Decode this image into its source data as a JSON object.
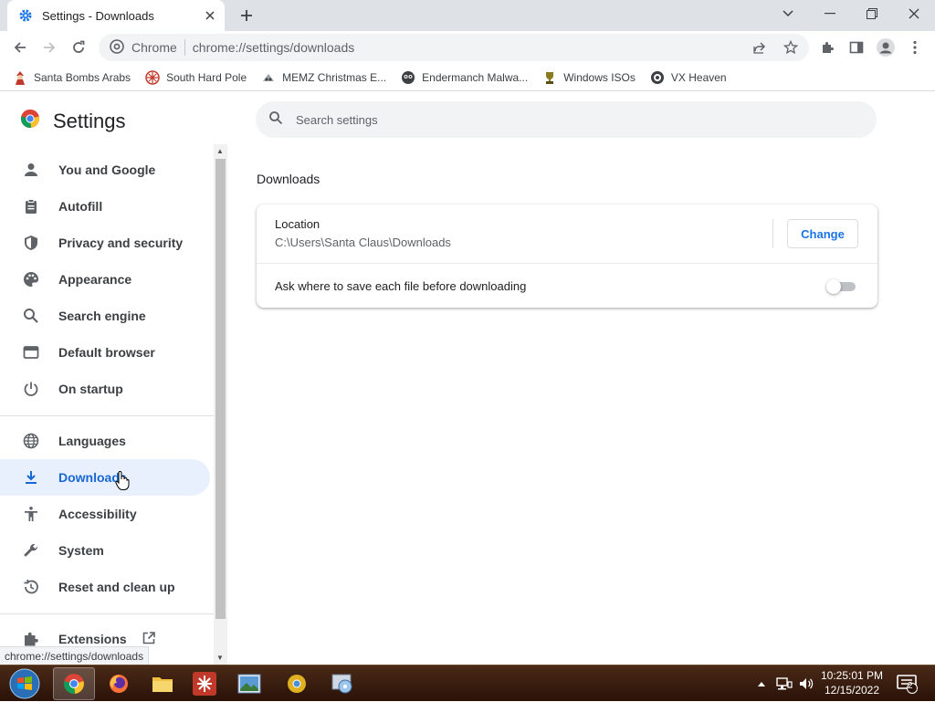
{
  "window": {
    "tab_title": "Settings - Downloads",
    "new_tab": "+"
  },
  "toolbar": {
    "site_label": "Chrome",
    "url": "chrome://settings/downloads"
  },
  "bookmarks": [
    {
      "label": "Santa Bombs Arabs",
      "icon": "santa-icon"
    },
    {
      "label": "South Hard Pole",
      "icon": "snowflake-icon"
    },
    {
      "label": "MEMZ Christmas E...",
      "icon": "memz-icon"
    },
    {
      "label": "Endermanch Malwa...",
      "icon": "enderman-icon"
    },
    {
      "label": "Windows ISOs",
      "icon": "trophy-icon"
    },
    {
      "label": "VX Heaven",
      "icon": "vx-icon"
    }
  ],
  "settings": {
    "title": "Settings",
    "search_placeholder": "Search settings"
  },
  "sidebar": {
    "items": [
      {
        "label": "You and Google",
        "icon": "person-icon"
      },
      {
        "label": "Autofill",
        "icon": "clipboard-icon"
      },
      {
        "label": "Privacy and security",
        "icon": "shield-icon"
      },
      {
        "label": "Appearance",
        "icon": "palette-icon"
      },
      {
        "label": "Search engine",
        "icon": "search-icon"
      },
      {
        "label": "Default browser",
        "icon": "browser-icon"
      },
      {
        "label": "On startup",
        "icon": "power-icon"
      },
      {
        "label": "Languages",
        "icon": "globe-icon"
      },
      {
        "label": "Downloads",
        "icon": "download-icon",
        "active": true
      },
      {
        "label": "Accessibility",
        "icon": "accessibility-icon"
      },
      {
        "label": "System",
        "icon": "wrench-icon"
      },
      {
        "label": "Reset and clean up",
        "icon": "history-icon"
      },
      {
        "label": "Extensions",
        "icon": "puzzle-icon"
      }
    ]
  },
  "downloads": {
    "section_title": "Downloads",
    "location_label": "Location",
    "location_path": "C:\\Users\\Santa Claus\\Downloads",
    "change_button": "Change",
    "ask_label": "Ask where to save each file before downloading",
    "ask_enabled": false
  },
  "status_bar": {
    "link_url": "chrome://settings/downloads"
  },
  "taskbar": {
    "apps": [
      "chrome",
      "firefox",
      "explorer",
      "app-red",
      "image-viewer",
      "chrome-yellow",
      "installer"
    ],
    "clock_time": "10:25:01 PM",
    "clock_date": "12/15/2022",
    "notification_count": "2"
  },
  "colors": {
    "accent": "#1a73e8",
    "active_nav_bg": "#e8f0fe",
    "active_nav_text": "#1967d2"
  }
}
